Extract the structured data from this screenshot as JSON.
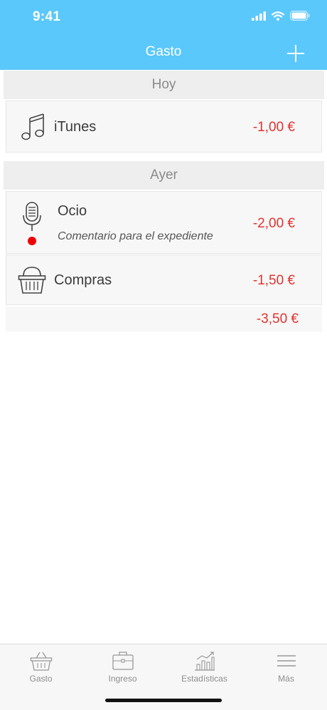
{
  "status_bar": {
    "time": "9:41"
  },
  "nav": {
    "title": "Gasto"
  },
  "sections": [
    {
      "header": "Hoy"
    },
    {
      "header": "Ayer"
    }
  ],
  "entries": [
    {
      "category": "iTunes",
      "amount": "-1,00 €",
      "icon": "music-note-icon"
    },
    {
      "category": "Ocio",
      "amount": "-2,00 €",
      "icon": "microphone-icon",
      "comment": "Comentario para el expediente"
    },
    {
      "category": "Compras",
      "amount": "-1,50 €",
      "icon": "shopping-basket-icon"
    }
  ],
  "total": {
    "amount": "-3,50 €"
  },
  "tabs": [
    {
      "label": "Gasto",
      "icon": "basket-icon"
    },
    {
      "label": "Ingreso",
      "icon": "briefcase-icon"
    },
    {
      "label": "Estadísticas",
      "icon": "chart-icon"
    },
    {
      "label": "Más",
      "icon": "menu-icon"
    }
  ],
  "colors": {
    "header": "#5ac8fa",
    "amount": "#e0332f",
    "dot": "#f00000"
  }
}
